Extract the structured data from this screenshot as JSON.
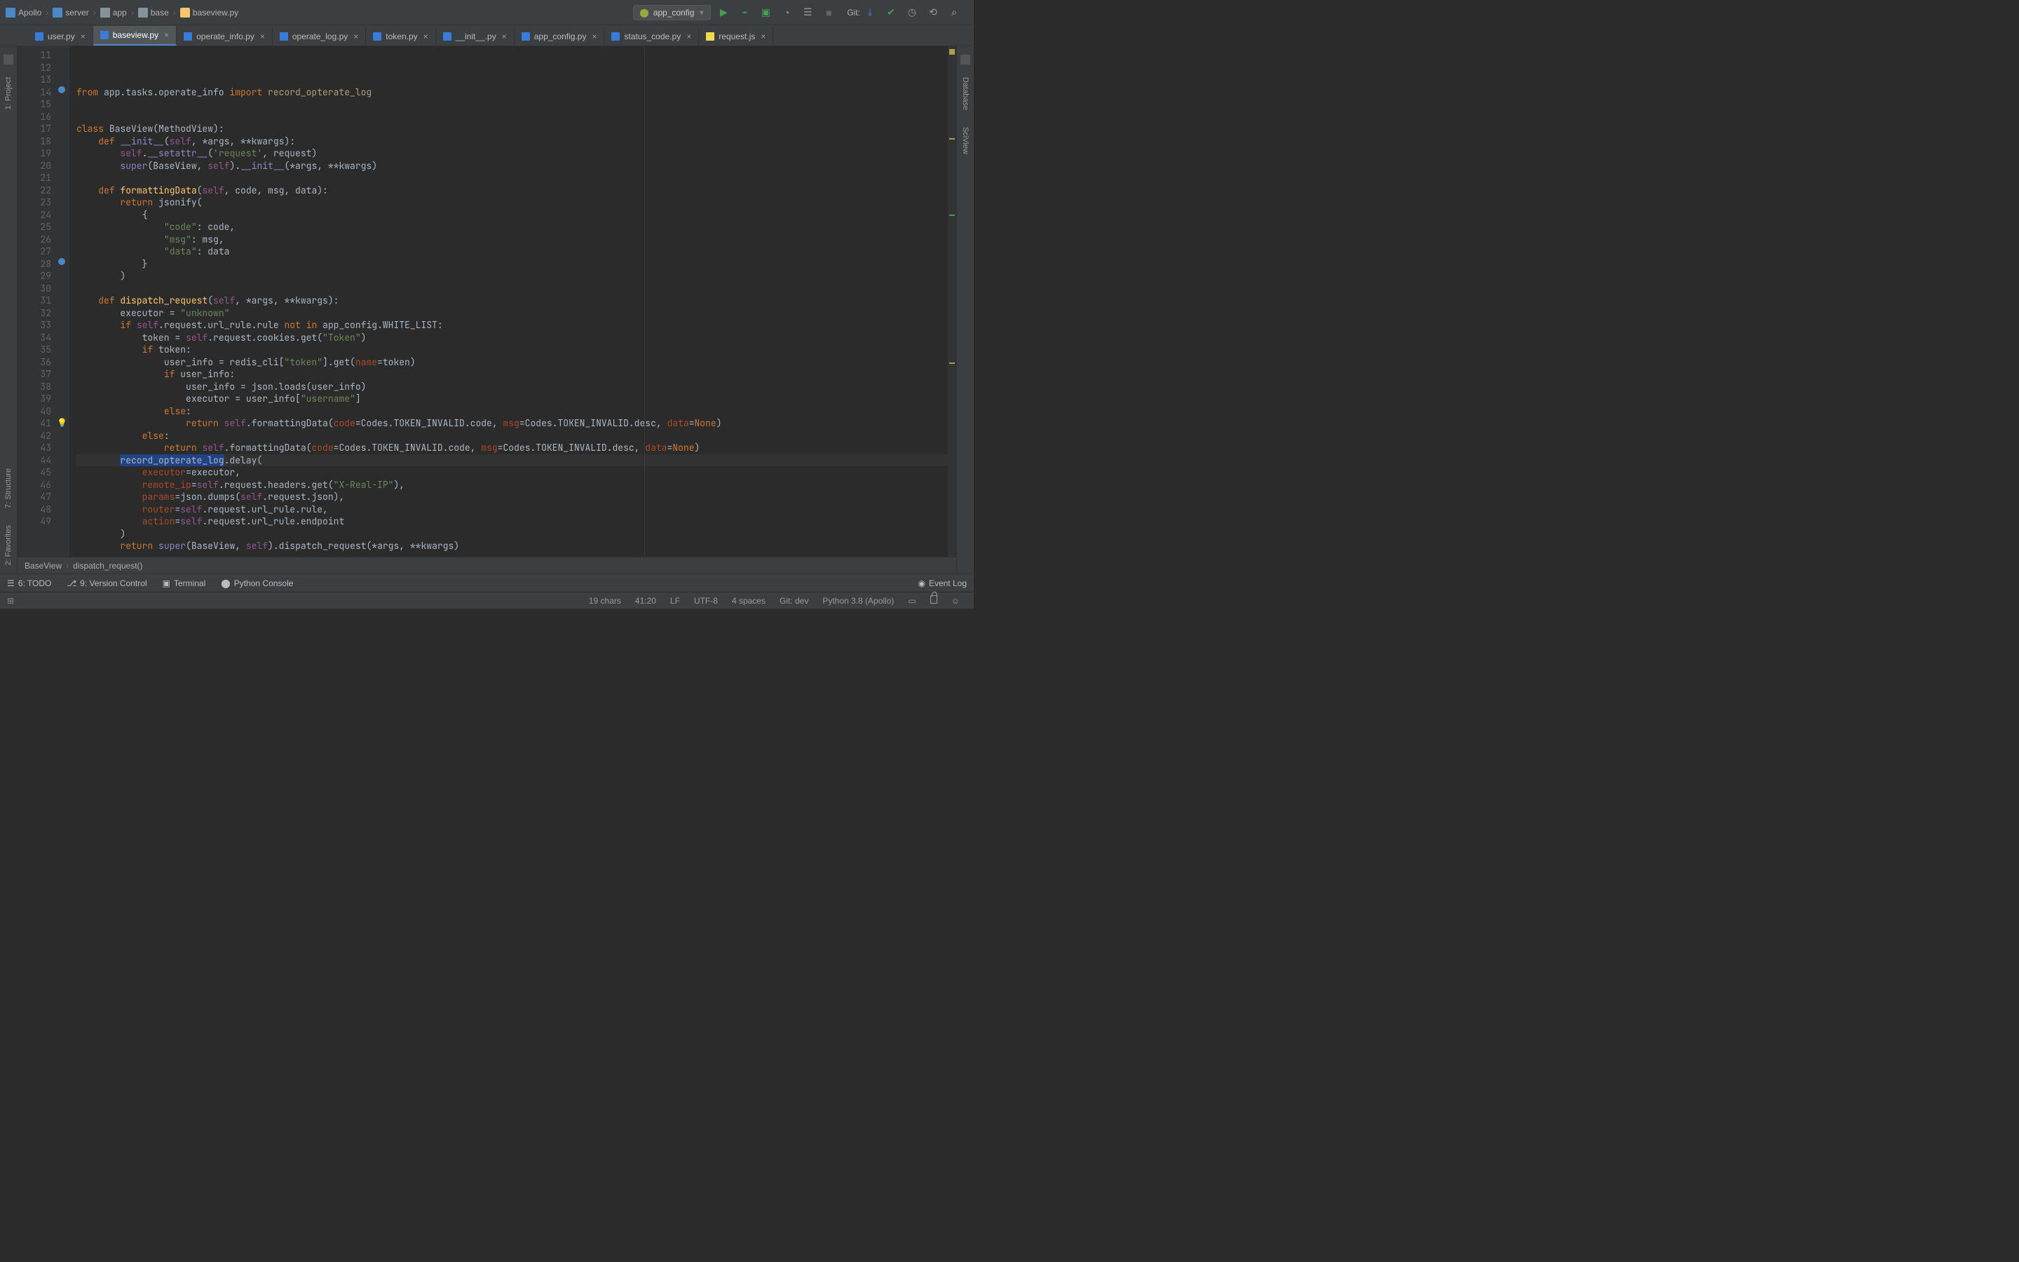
{
  "breadcrumb": {
    "items": [
      "Apollo",
      "server",
      "app",
      "base",
      "baseview.py"
    ]
  },
  "run_config": {
    "label": "app_config"
  },
  "git_label": "Git:",
  "tabs": [
    {
      "name": "user.py",
      "type": "py",
      "active": false
    },
    {
      "name": "baseview.py",
      "type": "py",
      "active": true
    },
    {
      "name": "operate_info.py",
      "type": "py",
      "active": false
    },
    {
      "name": "operate_log.py",
      "type": "py",
      "active": false
    },
    {
      "name": "token.py",
      "type": "py",
      "active": false
    },
    {
      "name": "__init__.py",
      "type": "py",
      "active": false
    },
    {
      "name": "app_config.py",
      "type": "py",
      "active": false
    },
    {
      "name": "status_code.py",
      "type": "py",
      "active": false
    },
    {
      "name": "request.js",
      "type": "js",
      "active": false
    }
  ],
  "left_tabs": {
    "project": "1: Project",
    "structure": "7: Structure",
    "favorites": "2: Favorites"
  },
  "right_tabs": {
    "database": "Database",
    "sciview": "SciView"
  },
  "line_start": 11,
  "line_end": 49,
  "code": {
    "11": {
      "pre": "",
      "tokens": [
        [
          "kw",
          "from"
        ],
        [
          "name",
          " app.tasks.operate_info "
        ],
        [
          "kw",
          "import"
        ],
        [
          "name",
          " "
        ],
        [
          "call",
          "record_opterate_log"
        ]
      ]
    },
    "12": {
      "pre": "",
      "tokens": []
    },
    "13": {
      "pre": "",
      "tokens": []
    },
    "14": {
      "pre": "",
      "tokens": [
        [
          "kw",
          "class"
        ],
        [
          "name",
          " BaseView(MethodView):"
        ]
      ]
    },
    "15": {
      "pre": "    ",
      "tokens": [
        [
          "kw",
          "def"
        ],
        [
          "name",
          " "
        ],
        [
          "bi",
          "__init__"
        ],
        [
          "name",
          "("
        ],
        [
          "self",
          "self"
        ],
        [
          "name",
          ", *args, **kwargs):"
        ]
      ]
    },
    "16": {
      "pre": "        ",
      "tokens": [
        [
          "self",
          "self"
        ],
        [
          "name",
          "."
        ],
        [
          "bi",
          "__setattr__"
        ],
        [
          "name",
          "("
        ],
        [
          "str",
          "'request'"
        ],
        [
          "name",
          ", request)"
        ]
      ]
    },
    "17": {
      "pre": "        ",
      "tokens": [
        [
          "bi",
          "super"
        ],
        [
          "name",
          "(BaseView, "
        ],
        [
          "self",
          "self"
        ],
        [
          "name",
          ")."
        ],
        [
          "bi",
          "__init__"
        ],
        [
          "name",
          "(*args, **kwargs)"
        ]
      ]
    },
    "18": {
      "pre": "",
      "tokens": []
    },
    "19": {
      "pre": "    ",
      "tokens": [
        [
          "kw",
          "def"
        ],
        [
          "name",
          " "
        ],
        [
          "fn",
          "formattingData"
        ],
        [
          "name",
          "("
        ],
        [
          "self",
          "self"
        ],
        [
          "name",
          ", code, msg, data):"
        ]
      ]
    },
    "20": {
      "pre": "        ",
      "tokens": [
        [
          "kw",
          "return"
        ],
        [
          "name",
          " jsonify("
        ]
      ]
    },
    "21": {
      "pre": "            ",
      "tokens": [
        [
          "name",
          "{"
        ]
      ]
    },
    "22": {
      "pre": "                ",
      "tokens": [
        [
          "str",
          "\"code\""
        ],
        [
          "name",
          ": code,"
        ]
      ]
    },
    "23": {
      "pre": "                ",
      "tokens": [
        [
          "str",
          "\"msg\""
        ],
        [
          "name",
          ": msg,"
        ]
      ]
    },
    "24": {
      "pre": "                ",
      "tokens": [
        [
          "str",
          "\"data\""
        ],
        [
          "name",
          ": data"
        ]
      ]
    },
    "25": {
      "pre": "            ",
      "tokens": [
        [
          "name",
          "}"
        ]
      ]
    },
    "26": {
      "pre": "        ",
      "tokens": [
        [
          "name",
          ")"
        ]
      ]
    },
    "27": {
      "pre": "",
      "tokens": []
    },
    "28": {
      "pre": "    ",
      "tokens": [
        [
          "kw",
          "def"
        ],
        [
          "name",
          " "
        ],
        [
          "fn",
          "dispatch_request"
        ],
        [
          "name",
          "("
        ],
        [
          "self",
          "self"
        ],
        [
          "name",
          ", *args, **kwargs):"
        ]
      ]
    },
    "29": {
      "pre": "        ",
      "tokens": [
        [
          "name",
          "executor = "
        ],
        [
          "str",
          "\"unknown\""
        ]
      ]
    },
    "30": {
      "pre": "        ",
      "tokens": [
        [
          "kw",
          "if"
        ],
        [
          "name",
          " "
        ],
        [
          "self",
          "self"
        ],
        [
          "name",
          ".request.url_rule.rule "
        ],
        [
          "kw",
          "not in"
        ],
        [
          "name",
          " app_config.WHITE_LIST:"
        ]
      ]
    },
    "31": {
      "pre": "            ",
      "tokens": [
        [
          "name",
          "token = "
        ],
        [
          "self",
          "self"
        ],
        [
          "name",
          ".request.cookies.get("
        ],
        [
          "str",
          "\"Token\""
        ],
        [
          "name",
          ")"
        ]
      ]
    },
    "32": {
      "pre": "            ",
      "tokens": [
        [
          "kw",
          "if"
        ],
        [
          "name",
          " token:"
        ]
      ]
    },
    "33": {
      "pre": "                ",
      "tokens": [
        [
          "name",
          "user_info = redis_cli["
        ],
        [
          "str",
          "\"token\""
        ],
        [
          "name",
          "].get("
        ],
        [
          "param",
          "name"
        ],
        [
          "name",
          "=token)"
        ]
      ]
    },
    "34": {
      "pre": "                ",
      "tokens": [
        [
          "kw",
          "if"
        ],
        [
          "name",
          " user_info:"
        ]
      ]
    },
    "35": {
      "pre": "                    ",
      "tokens": [
        [
          "name",
          "user_info = json.loads(user_info)"
        ]
      ]
    },
    "36": {
      "pre": "                    ",
      "tokens": [
        [
          "name",
          "executor = user_info["
        ],
        [
          "str",
          "\"username\""
        ],
        [
          "name",
          "]"
        ]
      ]
    },
    "37": {
      "pre": "                ",
      "tokens": [
        [
          "kw",
          "else"
        ],
        [
          "name",
          ":"
        ]
      ]
    },
    "38": {
      "pre": "                    ",
      "tokens": [
        [
          "kw",
          "return"
        ],
        [
          "name",
          " "
        ],
        [
          "self",
          "self"
        ],
        [
          "name",
          ".formattingData("
        ],
        [
          "param",
          "code"
        ],
        [
          "name",
          "=Codes.TOKEN_INVALID.code, "
        ],
        [
          "param",
          "msg"
        ],
        [
          "name",
          "=Codes.TOKEN_INVALID.desc, "
        ],
        [
          "param",
          "data"
        ],
        [
          "name",
          "="
        ],
        [
          "kw",
          "None"
        ],
        [
          "name",
          ")"
        ]
      ]
    },
    "39": {
      "pre": "            ",
      "tokens": [
        [
          "kw",
          "else"
        ],
        [
          "name",
          ":"
        ]
      ]
    },
    "40": {
      "pre": "                ",
      "tokens": [
        [
          "kw",
          "return"
        ],
        [
          "name",
          " "
        ],
        [
          "self",
          "self"
        ],
        [
          "name",
          ".formattingData("
        ],
        [
          "param",
          "code"
        ],
        [
          "name",
          "=Codes.TOKEN_INVALID.code, "
        ],
        [
          "param",
          "msg"
        ],
        [
          "name",
          "=Codes.TOKEN_INVALID.desc, "
        ],
        [
          "param",
          "data"
        ],
        [
          "name",
          "="
        ],
        [
          "kw",
          "None"
        ],
        [
          "name",
          ")"
        ]
      ]
    },
    "41": {
      "pre": "        ",
      "tokens": [
        [
          "hl",
          "record_opterate_log"
        ],
        [
          "name",
          ".delay("
        ]
      ],
      "current": true,
      "bulb": true
    },
    "42": {
      "pre": "            ",
      "tokens": [
        [
          "param",
          "executor"
        ],
        [
          "name",
          "=executor,"
        ]
      ]
    },
    "43": {
      "pre": "            ",
      "tokens": [
        [
          "param",
          "remote_ip"
        ],
        [
          "name",
          "="
        ],
        [
          "self",
          "self"
        ],
        [
          "name",
          ".request.headers.get("
        ],
        [
          "str",
          "\"X-Real-IP\""
        ],
        [
          "name",
          "),"
        ]
      ]
    },
    "44": {
      "pre": "            ",
      "tokens": [
        [
          "param",
          "params"
        ],
        [
          "name",
          "=json.dumps("
        ],
        [
          "self",
          "self"
        ],
        [
          "name",
          ".request.json),"
        ]
      ]
    },
    "45": {
      "pre": "            ",
      "tokens": [
        [
          "param",
          "router"
        ],
        [
          "name",
          "="
        ],
        [
          "self",
          "self"
        ],
        [
          "name",
          ".request.url_rule.rule,"
        ]
      ]
    },
    "46": {
      "pre": "            ",
      "tokens": [
        [
          "param",
          "action"
        ],
        [
          "name",
          "="
        ],
        [
          "self",
          "self"
        ],
        [
          "name",
          ".request.url_rule.endpoint"
        ]
      ]
    },
    "47": {
      "pre": "        ",
      "tokens": [
        [
          "name",
          ")"
        ]
      ]
    },
    "48": {
      "pre": "        ",
      "tokens": [
        [
          "kw",
          "return"
        ],
        [
          "name",
          " "
        ],
        [
          "bi",
          "super"
        ],
        [
          "name",
          "(BaseView, "
        ],
        [
          "self",
          "self"
        ],
        [
          "name",
          ").dispatch_request(*args, **kwargs)"
        ]
      ]
    },
    "49": {
      "pre": "",
      "tokens": []
    }
  },
  "overrides": {
    "14": true,
    "28": true
  },
  "crumb_bottom": {
    "class": "BaseView",
    "method": "dispatch_request()"
  },
  "tool_windows": {
    "todo": "6: TODO",
    "vcs": "9: Version Control",
    "terminal": "Terminal",
    "pyconsole": "Python Console",
    "eventlog": "Event Log"
  },
  "status": {
    "chars": "19 chars",
    "pos": "41:20",
    "le": "LF",
    "enc": "UTF-8",
    "indent": "4 spaces",
    "git": "Git: dev",
    "interp": "Python 3.8 (Apollo)"
  }
}
